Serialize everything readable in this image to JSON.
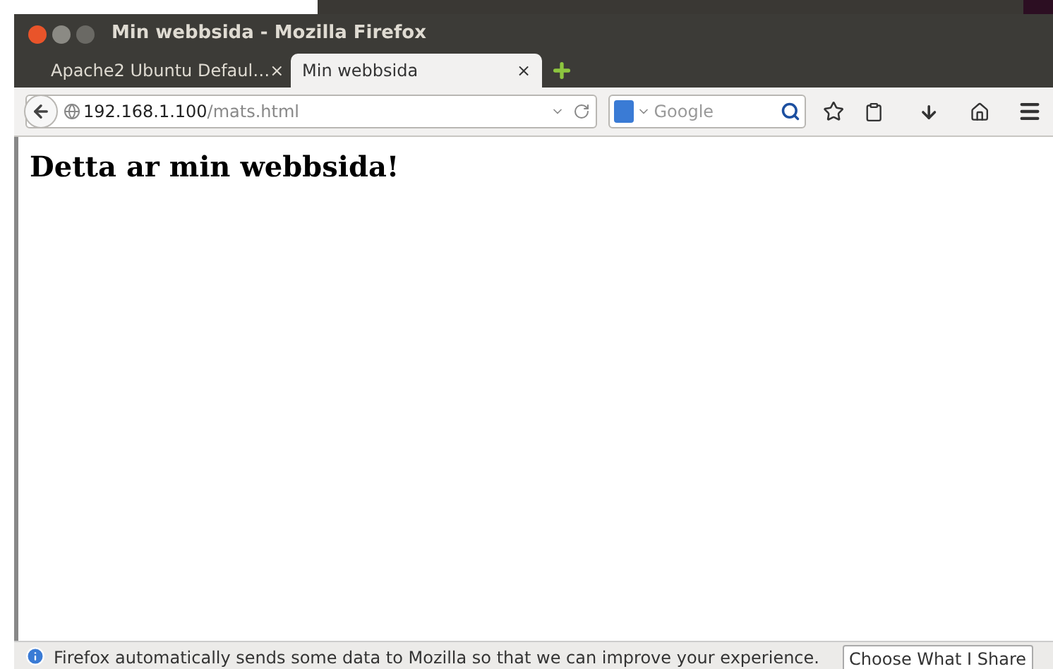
{
  "window": {
    "title": "Min webbsida - Mozilla Firefox"
  },
  "tabs": [
    {
      "label": "Apache2 Ubuntu Defaul…",
      "close": "×",
      "selected": false
    },
    {
      "label": "Min webbsida",
      "close": "×",
      "selected": true
    }
  ],
  "address_bar": {
    "host": "192.168.1.100",
    "path": "/mats.html"
  },
  "search": {
    "placeholder": "Google"
  },
  "page": {
    "heading": "Detta ar min webbsida!"
  },
  "notification": {
    "message": "Firefox automatically sends some data to Mozilla so that we can improve your experience.",
    "button": "Choose What I Share"
  }
}
